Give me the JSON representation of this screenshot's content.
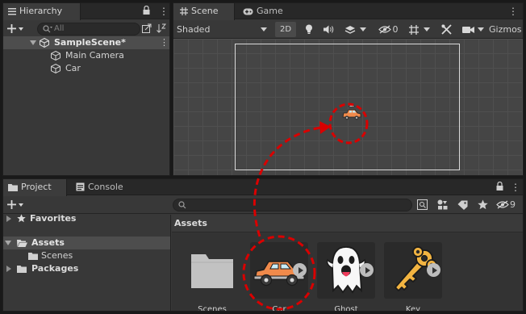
{
  "hierarchy": {
    "tab_label": "Hierarchy",
    "search_placeholder": "All",
    "scene_name": "SampleScene*",
    "objects": [
      {
        "label": "Main Camera"
      },
      {
        "label": "Car"
      }
    ]
  },
  "scene_view": {
    "tabs": [
      {
        "label": "Scene"
      },
      {
        "label": "Game"
      }
    ],
    "shading_mode": "Shaded",
    "mode_2d_label": "2D",
    "hidden_count": "0",
    "gizmos_label": "Gizmos"
  },
  "project": {
    "tabs": [
      {
        "label": "Project"
      },
      {
        "label": "Console"
      }
    ],
    "hidden_count": "9",
    "tree": {
      "favorites": "Favorites",
      "assets": "Assets",
      "scenes": "Scenes",
      "packages": "Packages"
    },
    "breadcrumb": "Assets",
    "assets": [
      {
        "label": "Scenes",
        "icon": "folder-icon"
      },
      {
        "label": "Car",
        "icon": "car-sprite-icon"
      },
      {
        "label": "Ghost",
        "icon": "ghost-sprite-icon"
      },
      {
        "label": "Key",
        "icon": "key-sprite-icon"
      }
    ]
  },
  "annotation": {
    "color": "#d90000"
  },
  "colors": {
    "panel": "#383838",
    "scene_background": "#454545",
    "selection": "#4d4d4d",
    "car_body": "#f08a4b",
    "key_gold": "#f2b441"
  }
}
